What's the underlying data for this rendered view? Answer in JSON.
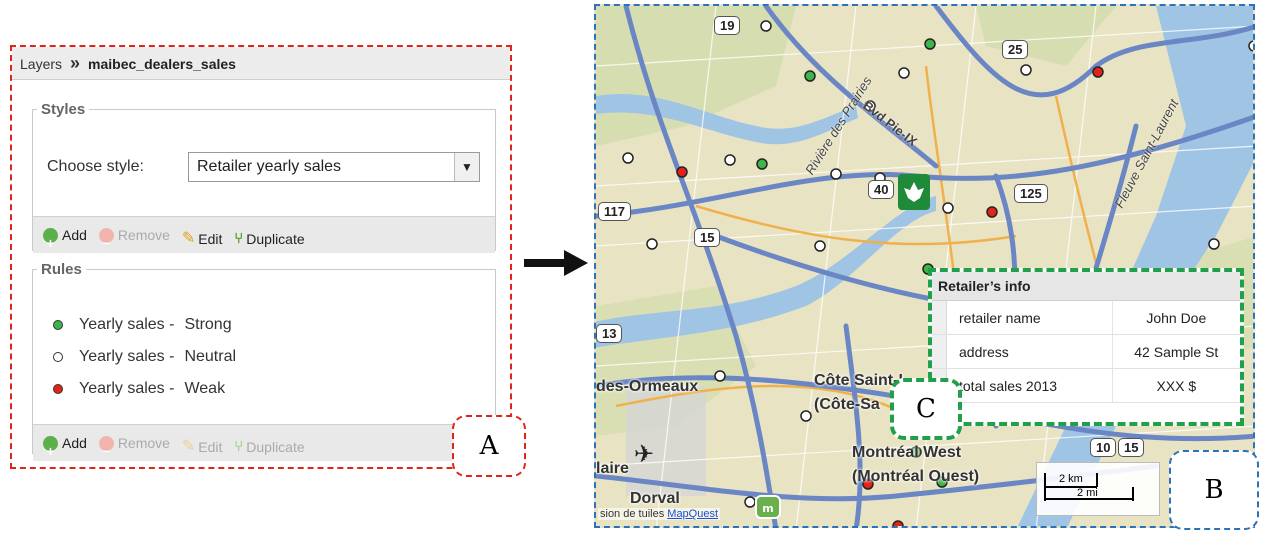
{
  "layers_panel": {
    "breadcrumb_root": "Layers",
    "breadcrumb_sep": "»",
    "layer_name": "maibec_dealers_sales",
    "styles": {
      "legend": "Styles",
      "choose_label": "Choose style:",
      "selected_style": "Retailer yearly sales",
      "toolbar": {
        "add": "Add",
        "remove": "Remove",
        "edit": "Edit",
        "duplicate": "Duplicate"
      }
    },
    "rules": {
      "legend": "Rules",
      "items": [
        {
          "label": "Yearly sales -",
          "value": "Strong",
          "color": "#3db54a"
        },
        {
          "label": "Yearly sales -",
          "value": "Neutral",
          "color": "#ffffff"
        },
        {
          "label": "Yearly sales -",
          "value": "Weak",
          "color": "#e2231a"
        }
      ],
      "toolbar": {
        "add": "Add",
        "remove": "Remove",
        "edit": "Edit",
        "duplicate": "Duplicate"
      }
    }
  },
  "callouts": {
    "a": "A",
    "b": "B",
    "c": "C"
  },
  "retailer_info": {
    "title": "Retailer’s info",
    "rows": [
      {
        "key": "retailer name",
        "value": "John Doe"
      },
      {
        "key": "address",
        "value": "42 Sample St"
      },
      {
        "key": "total sales 2013",
        "value": "XXX $"
      }
    ]
  },
  "map": {
    "places": [
      "Côte Saint-L",
      "(Côte-Sa",
      "Montréal West",
      "(Montréal Ouest)",
      "des-Ormeaux",
      "Dorval",
      "laire"
    ],
    "streets": [
      "Rivière des Prairies",
      "Bvd Pie-IX",
      "Fleuve Saint-Laurent"
    ],
    "shields": [
      "19",
      "25",
      "40",
      "117",
      "15",
      "125",
      "13",
      "10",
      "15"
    ],
    "scale": {
      "km": "2 km",
      "mi": "2 mi"
    },
    "credit_prefix": "sion de tuiles",
    "credit_link": "MapQuest"
  },
  "colors": {
    "strong": "#3db54a",
    "neutral": "#ffffff",
    "weak": "#e2231a",
    "frame_a": "#e2231a",
    "frame_b": "#2b72b8",
    "frame_c": "#21a04a"
  }
}
